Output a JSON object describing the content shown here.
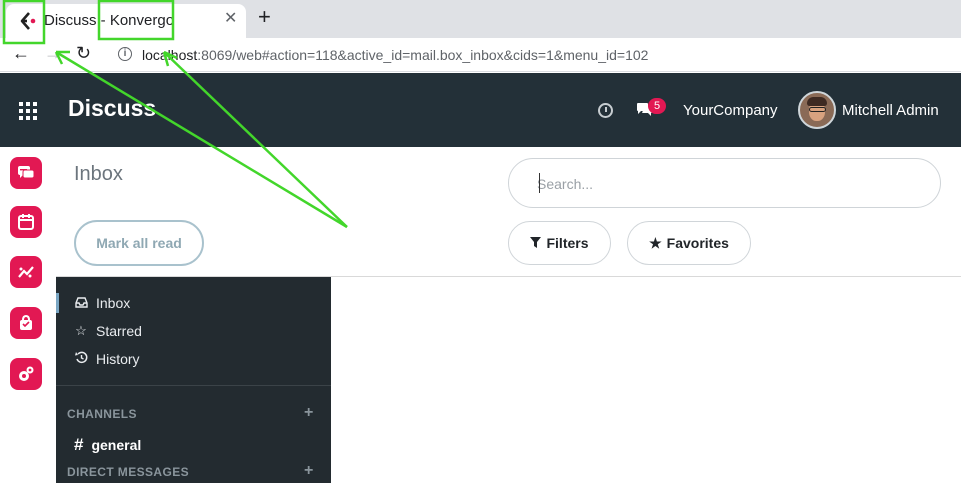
{
  "browser": {
    "tab_title": "Discuss - Konvergo",
    "new_tab": "+",
    "close": "✕",
    "url_host": "localhost",
    "url_rest": ":8069/web#action=118&active_id=mail.box_inbox&cids=1&menu_id=102"
  },
  "navbar": {
    "app_name": "Discuss",
    "message_count": "5",
    "company": "YourCompany",
    "user": "Mitchell Admin"
  },
  "control_panel": {
    "breadcrumb": "Inbox",
    "mark_all_read": "Mark all read",
    "search_placeholder": "Search...",
    "filters": "Filters",
    "favorites": "Favorites"
  },
  "sidebar": {
    "mailboxes": [
      {
        "label": "Inbox",
        "icon": "inbox-icon",
        "active": true
      },
      {
        "label": "Starred",
        "icon": "star-icon",
        "active": false
      },
      {
        "label": "History",
        "icon": "history-icon",
        "active": false
      }
    ],
    "channels_header": "CHANNELS",
    "channels": [
      {
        "label": "general"
      }
    ],
    "direct_messages_header": "DIRECT MESSAGES"
  },
  "app_icons": [
    "discuss-icon",
    "calendar-icon",
    "crm-icon",
    "sales-icon",
    "settings-icon"
  ],
  "colors": {
    "navbar_bg": "#233038",
    "accent": "#e21853",
    "sidebar_bg": "#232b30",
    "annotation": "#43d62b"
  }
}
